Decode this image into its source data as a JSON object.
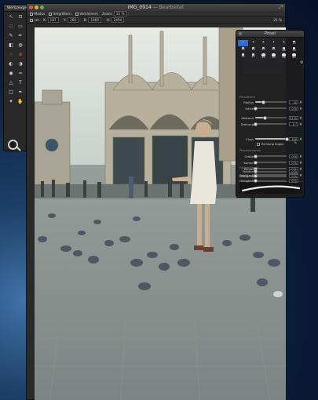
{
  "window": {
    "title": "IMG_0914",
    "edited": "Bearbeitet",
    "title_separator": "—"
  },
  "toolbar1": {
    "items": [
      "Modus",
      "Vergrößern",
      "Verkleinern"
    ],
    "zoom_label": "Zoom:",
    "zoom_value": "21 %"
  },
  "toolbar2": {
    "unit": "cm",
    "x_label": "X:",
    "x_value": "187",
    "y_label": "Y:",
    "y_value": "260",
    "w_label": "B:",
    "w_value": "1860",
    "h_label": "H:",
    "h_value": "2404",
    "zoom_value": "21 %"
  },
  "tools_palette": {
    "title": "Werkzeuge",
    "tools": [
      "arrow-tool-icon",
      "crop-tool-icon",
      "lasso-tool-icon",
      "marquee-tool-icon",
      "brush-tool-icon",
      "pencil-tool-icon",
      "eraser-tool-icon",
      "fill-tool-icon",
      "smudge-tool-icon",
      "clone-tool-icon",
      "dodge-tool-icon",
      "burn-tool-icon",
      "sponge-tool-icon",
      "blur-tool-icon",
      "sharpen-tool-icon",
      "text-tool-icon",
      "shape-tool-icon",
      "pen-tool-icon",
      "eyedropper-tool-icon",
      "hand-tool-icon"
    ],
    "tool_glyphs": [
      "↖",
      "⊡",
      "◌",
      "▭",
      "✎",
      "✏",
      "◧",
      "◍",
      "☝",
      "⊕",
      "◐",
      "◑",
      "◉",
      "≈",
      "△",
      "T",
      "□",
      "✒",
      "✦",
      "✋"
    ],
    "magnifier": "magnifier-icon",
    "accent_colors": [
      "#e9a23b",
      "#d94f3d",
      "#3aa0e8"
    ]
  },
  "pinsel": {
    "title": "Pinsel",
    "brush_sizes": [
      "1",
      "3",
      "5",
      "7",
      "9",
      "13",
      "16",
      "18",
      "20",
      "25",
      "28",
      "30",
      "35",
      "40",
      "45",
      "50",
      "55",
      "60"
    ],
    "selected_index": 0,
    "sections": {
      "form": "Pinselform",
      "dynamics": "Pinseldynamik",
      "color": "Farbdynamik",
      "mode": "Modus"
    },
    "rows": [
      {
        "label": "Radius",
        "value": "11",
        "fraction": 0.25
      },
      {
        "label": "Härte",
        "value": "0 %",
        "fraction": 0.0
      },
      {
        "label": "Abstand",
        "value": "11 %",
        "fraction": 0.3
      },
      {
        "label": "Drehung",
        "value": "0 °",
        "fraction": 0.0
      },
      {
        "label": "Fluss",
        "value": "100 %",
        "fraction": 1.0
      },
      {
        "label": "Größe",
        "value": "0 %",
        "fraction": 0.0
      },
      {
        "label": "Kontur",
        "value": "0 %",
        "fraction": 0.0
      },
      {
        "label": "Winkel",
        "value": "0 %",
        "fraction": 0.0
      },
      {
        "label": "Deckkraft",
        "value": "0 %",
        "fraction": 0.0
      },
      {
        "label": "Farbton",
        "value": "0 %",
        "fraction": 0.0
      },
      {
        "label": "Sättigung",
        "value": "0 %",
        "fraction": 0.0
      },
      {
        "label": "Helligkeit",
        "value": "0 %",
        "fraction": 0.0
      }
    ],
    "checkbox_label": "Richtung folgen"
  }
}
